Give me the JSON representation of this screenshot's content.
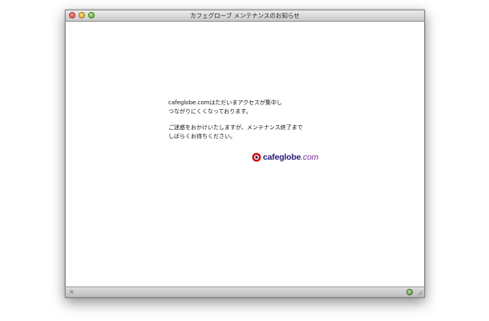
{
  "window": {
    "title": "カフェグローブ メンテナンスのお知らせ"
  },
  "message": {
    "paragraph1_line1": "cafeglobe.comはただいまアクセスが集中し",
    "paragraph1_line2": "つながりにくくなっております。",
    "paragraph2_line1": "ご迷惑をおかけいたしますが、メンテナンス終了まで",
    "paragraph2_line2": "しばらくお待ちください。"
  },
  "logo": {
    "name": "cafeglobe",
    "suffix": ".com"
  },
  "statusbar": {
    "close_glyph": "×"
  },
  "colors": {
    "logo_text": "#2a1a7a",
    "logo_mark": "#cc1111"
  }
}
